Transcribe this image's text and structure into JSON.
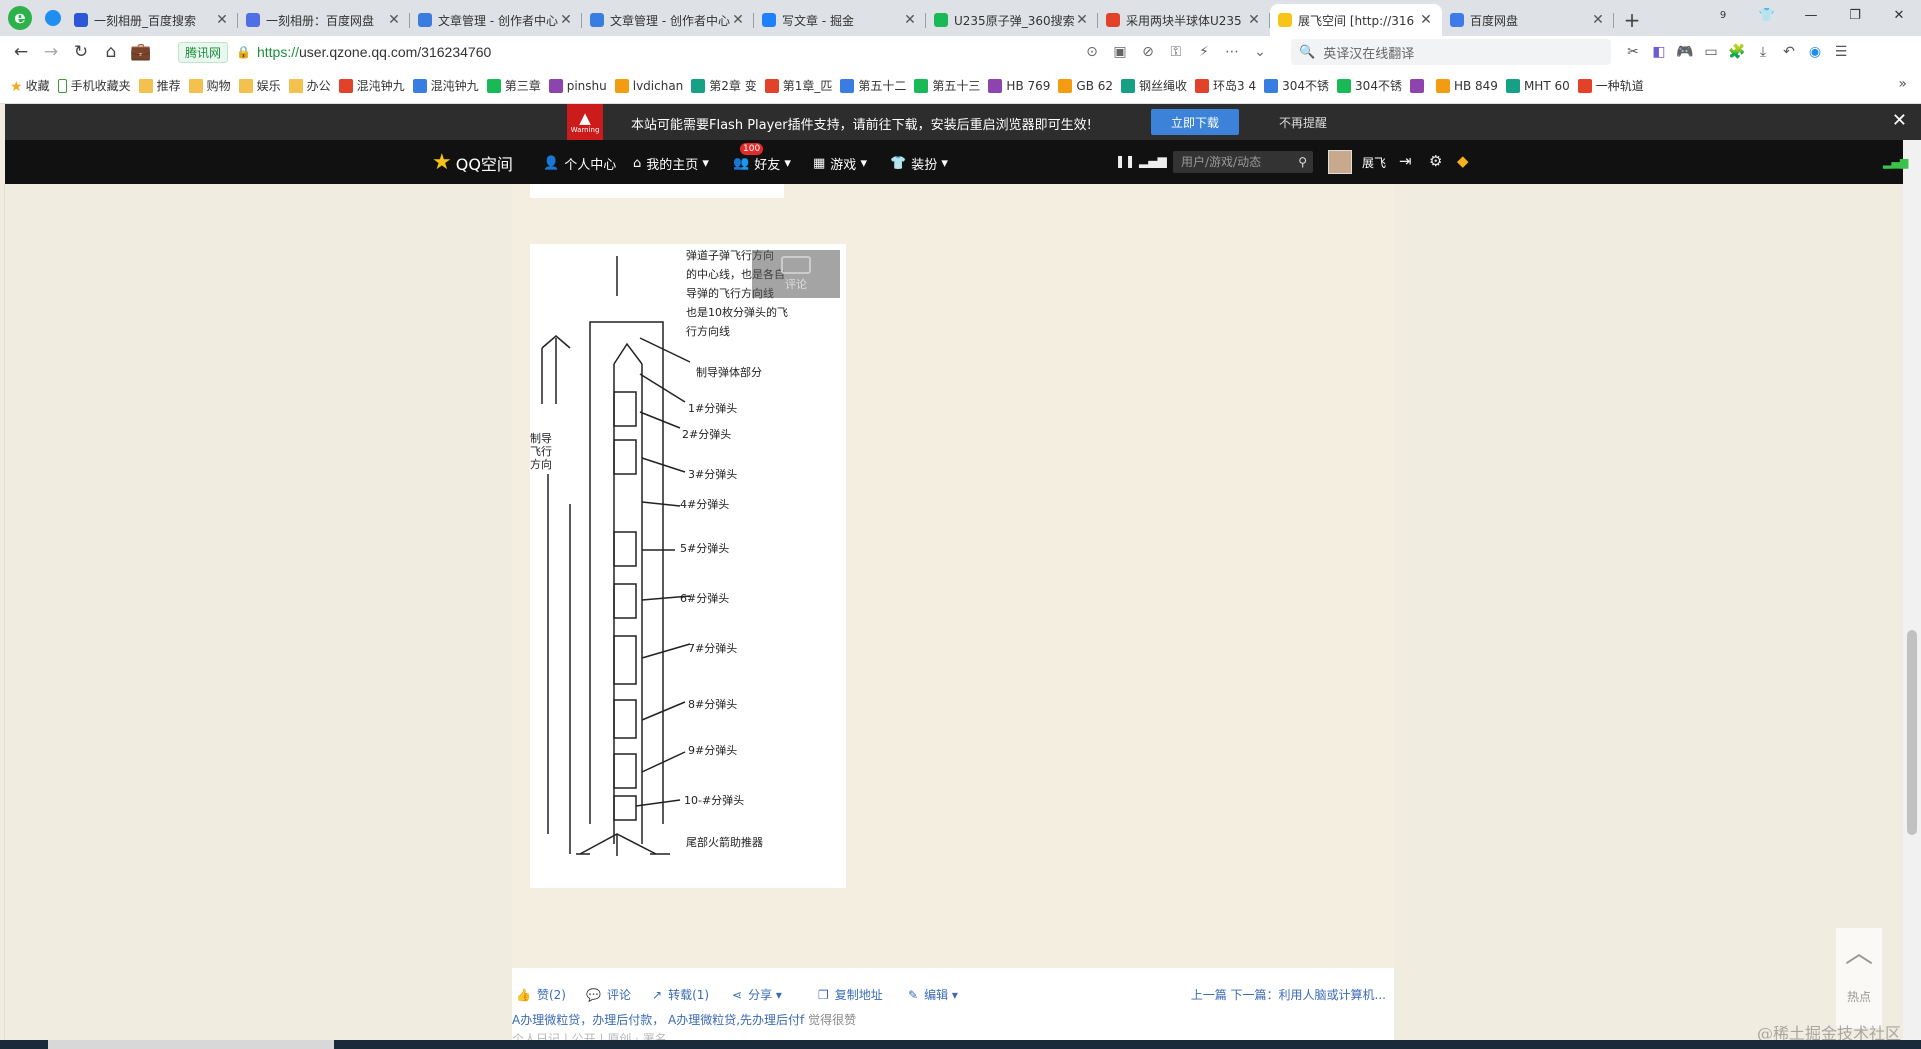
{
  "browser": {
    "tabs": [
      {
        "title": "一刻相册_百度搜索",
        "favicon_color": "#2d57d6",
        "active": false
      },
      {
        "title": "一刻相册：百度网盘",
        "favicon_color": "#4f6fe5",
        "active": false
      },
      {
        "title": "文章管理 - 创作者中心",
        "favicon_color": "#3a7de0",
        "active": false
      },
      {
        "title": "文章管理 - 创作者中心",
        "favicon_color": "#3a7de0",
        "active": false
      },
      {
        "title": "写文章 - 掘金",
        "favicon_color": "#1e80ff",
        "active": false
      },
      {
        "title": "U235原子弹_360搜索",
        "favicon_color": "#19b955",
        "active": false
      },
      {
        "title": "采用两块半球体U235",
        "favicon_color": "#e2412a",
        "active": false
      },
      {
        "title": "展飞空间 [http://316",
        "favicon_color": "#f5c518",
        "active": true
      },
      {
        "title": "百度网盘",
        "favicon_color": "#3d7be8",
        "active": false
      }
    ],
    "tab_count_badge": "9",
    "address": {
      "secure_label": "腾讯网",
      "url_scheme": "https://",
      "url_rest": "user.qzone.qq.com/316234760"
    },
    "search_placeholder": "英译汉在线翻译",
    "bookmarks": [
      {
        "label": "收藏",
        "icon": "star-icon"
      },
      {
        "label": "手机收藏夹",
        "icon": "phone-icon"
      },
      {
        "label": "推荐",
        "icon": "folder-icon"
      },
      {
        "label": "购物",
        "icon": "folder-icon"
      },
      {
        "label": "娱乐",
        "icon": "folder-icon"
      },
      {
        "label": "办公",
        "icon": "folder-icon"
      },
      {
        "label": "混沌钟九",
        "icon": "site-icon"
      },
      {
        "label": "混沌钟九",
        "icon": "site-icon"
      },
      {
        "label": "第三章",
        "icon": "site-icon"
      },
      {
        "label": "pinshu",
        "icon": "site-icon"
      },
      {
        "label": "lvdichan",
        "icon": "site-icon"
      },
      {
        "label": "第2章 变",
        "icon": "site-icon"
      },
      {
        "label": "第1章_匹",
        "icon": "site-icon"
      },
      {
        "label": "第五十二",
        "icon": "site-icon"
      },
      {
        "label": "第五十三",
        "icon": "site-icon"
      },
      {
        "label": "HB 769",
        "icon": "site-icon"
      },
      {
        "label": "GB 62",
        "icon": "site-icon"
      },
      {
        "label": "钢丝绳收",
        "icon": "site-icon"
      },
      {
        "label": "环岛3 4",
        "icon": "site-icon"
      },
      {
        "label": "304不锈",
        "icon": "site-icon"
      },
      {
        "label": "304不锈",
        "icon": "site-icon"
      },
      {
        "label": "",
        "icon": "site-icon"
      },
      {
        "label": "HB 849",
        "icon": "site-icon"
      },
      {
        "label": "MHT 60",
        "icon": "site-icon"
      },
      {
        "label": "一种轨道",
        "icon": "site-icon"
      }
    ]
  },
  "flash_bar": {
    "warning_label": "Warning",
    "message": "本站可能需要Flash Player插件支持，请前往下载，安装后重启浏览器即可生效!",
    "download_button": "立即下载",
    "dismiss_link": "不再提醒"
  },
  "qzone_nav": {
    "logo_text": "QQ空间",
    "items": {
      "personal": "个人中心",
      "home": "我的主页",
      "friends": "好友",
      "games": "游戏",
      "dress": "装扮"
    },
    "friends_badge": "100",
    "search_placeholder": "用户/游戏/动态",
    "username": "展飞"
  },
  "article": {
    "comment_overlay": "评论",
    "sketch_labels": {
      "note_lines": [
        "弹道子弹飞行方向",
        "的中心线，也是各自",
        "导弹的飞行方向线",
        "也是10枚分弹头的飞",
        "行方向线"
      ],
      "left_note": [
        "制导",
        "飞行",
        "方向"
      ],
      "top_shell": "制导弹体部分",
      "w1": "1#分弹头",
      "w2": "2#分弹头",
      "w3": "3#分弹头",
      "w4": "4#分弹头",
      "w5": "5#分弹头",
      "w6": "6#分弹头",
      "w7": "7#分弹头",
      "w8": "8#分弹头",
      "w9": "9#分弹头",
      "w10": "10-#分弹头",
      "base": "尾部火箭助推器"
    }
  },
  "actions": {
    "like": "赞(2)",
    "comment": "评论",
    "forward": "转载(1)",
    "share": "分享",
    "copy": "复制地址",
    "edit": "编辑",
    "prev_next": "上一篇  下一篇：利用人脑或计算机...",
    "tags_text": "A办理微粒贷，办理后付款，  A办理微粒贷,先办理后付f",
    "tags_gray": "觉得很赞",
    "tags_line2": "个人日记 | 公开 | 原创 · 署名"
  },
  "side_tools": {
    "top_label": "热点"
  },
  "watermark": "@稀土掘金技术社区"
}
